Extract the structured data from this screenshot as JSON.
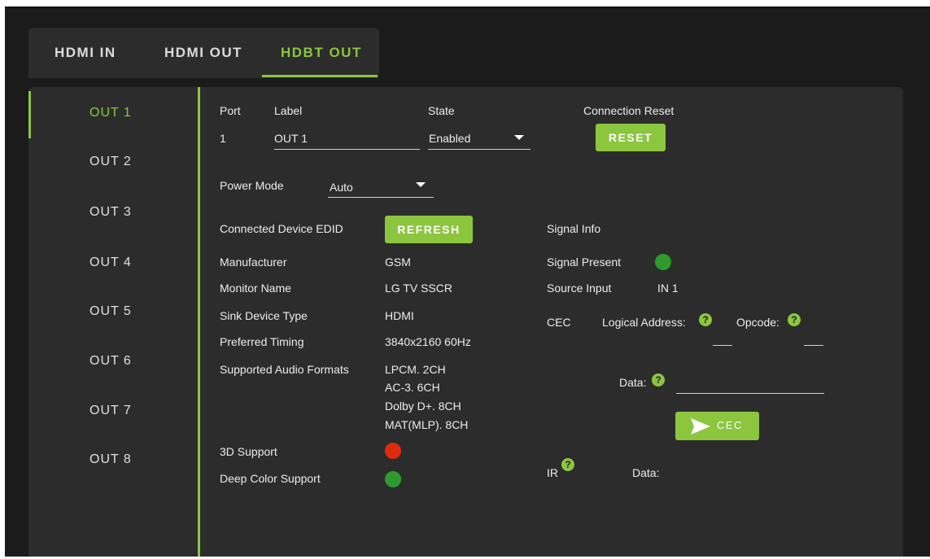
{
  "tabs": [
    {
      "label": "HDMI IN"
    },
    {
      "label": "HDMI OUT"
    },
    {
      "label": "HDBT OUT",
      "active": true
    }
  ],
  "sidebar": {
    "items": [
      {
        "label": "OUT 1",
        "active": true
      },
      {
        "label": "OUT 2"
      },
      {
        "label": "OUT 3"
      },
      {
        "label": "OUT 4"
      },
      {
        "label": "OUT 5"
      },
      {
        "label": "OUT 6"
      },
      {
        "label": "OUT 7"
      },
      {
        "label": "OUT 8"
      }
    ]
  },
  "port": {
    "port_header": "Port",
    "label_header": "Label",
    "state_header": "State",
    "reset_header": "Connection Reset",
    "port_value": "1",
    "label_value": "OUT 1",
    "state_value": "Enabled",
    "reset_button": "RESET"
  },
  "power": {
    "label": "Power Mode",
    "value": "Auto"
  },
  "edid": {
    "title": "Connected Device EDID",
    "refresh_button": "REFRESH",
    "manufacturer_label": "Manufacturer",
    "manufacturer_value": "GSM",
    "monitor_label": "Monitor Name",
    "monitor_value": "LG TV SSCR",
    "sink_label": "Sink Device Type",
    "sink_value": "HDMI",
    "timing_label": "Preferred Timing",
    "timing_value": "3840x2160 60Hz",
    "audio_label": "Supported Audio Formats",
    "audio_formats": [
      "LPCM. 2CH",
      "AC-3. 6CH",
      "Dolby D+. 8CH",
      "MAT(MLP). 8CH"
    ],
    "support3d_label": "3D Support",
    "deepcolor_label": "Deep Color Support"
  },
  "signal": {
    "title": "Signal Info",
    "present_label": "Signal Present",
    "source_label": "Source Input",
    "source_value": "IN 1"
  },
  "cec": {
    "label": "CEC",
    "logical_label": "Logical Address:",
    "opcode_label": "Opcode:",
    "data_label": "Data:",
    "send_button": "CEC"
  },
  "ir": {
    "label": "IR",
    "data_label": "Data:"
  },
  "help_glyph": "?",
  "colors": {
    "accent": "#8cc63f",
    "status_off": "#e02a10",
    "status_on": "#2e9a2e"
  }
}
